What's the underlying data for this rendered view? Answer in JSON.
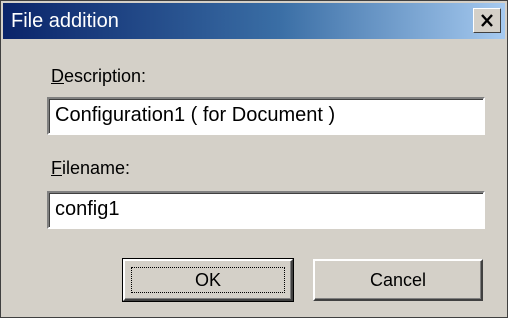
{
  "window": {
    "title": "File addition",
    "close_icon": "close-icon"
  },
  "description": {
    "label_accel": "D",
    "label_rest": "escription:",
    "value": "Configuration1 ( for Document )"
  },
  "filename": {
    "label_accel": "F",
    "label_rest": "ilename:",
    "value": "config1"
  },
  "buttons": {
    "ok_label": "OK",
    "cancel_label": "Cancel"
  }
}
